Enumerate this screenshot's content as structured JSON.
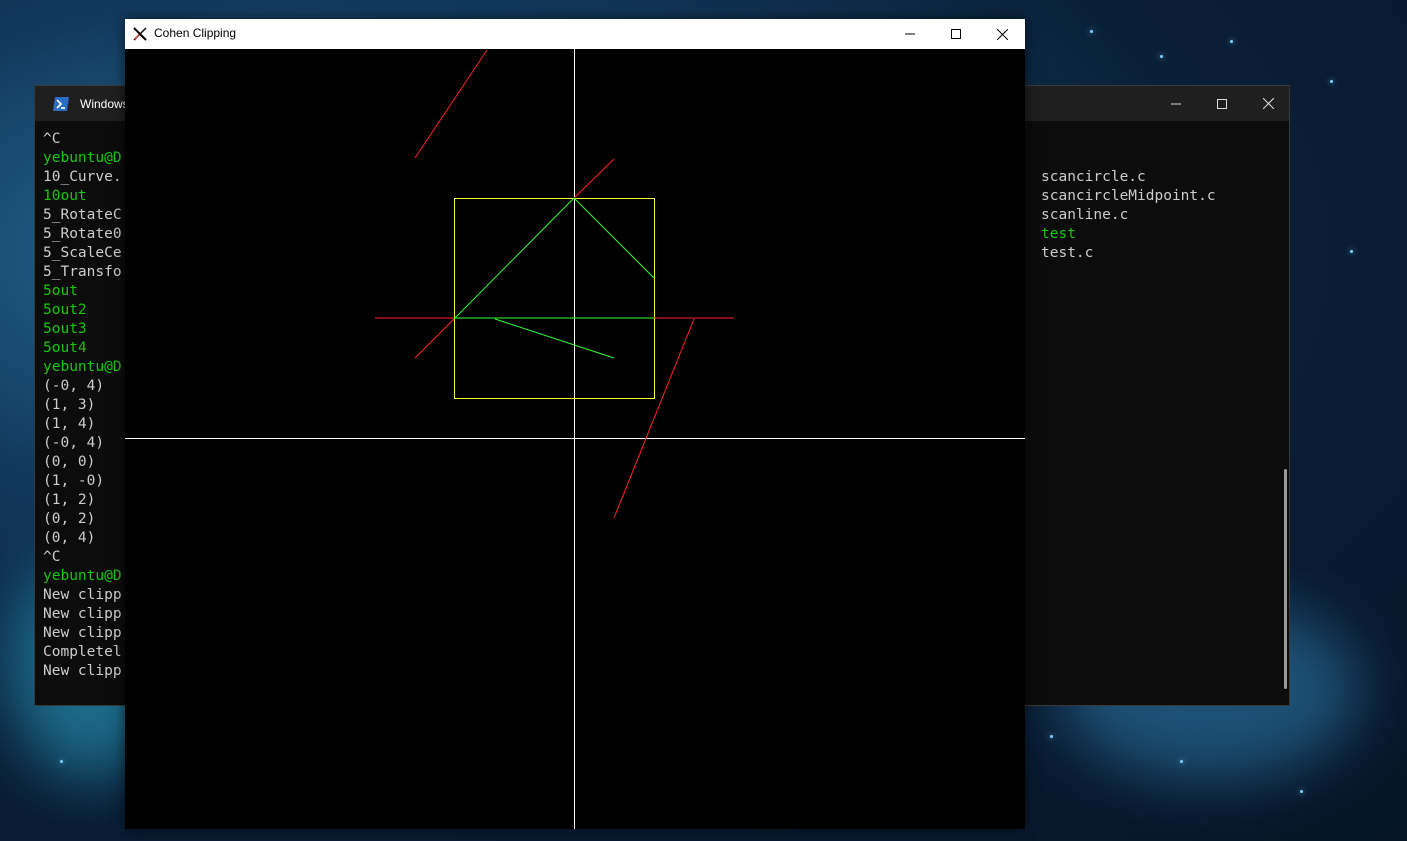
{
  "terminal": {
    "title": "Windows",
    "left_lines": [
      {
        "text": "^C",
        "color": "white"
      },
      {
        "text": "yebuntu@D",
        "color": "green"
      },
      {
        "text": "10_Curve.",
        "color": "white"
      },
      {
        "text": "10out",
        "color": "green"
      },
      {
        "text": "5_RotateC",
        "color": "white"
      },
      {
        "text": "5_Rotate0",
        "color": "white"
      },
      {
        "text": "5_ScaleCe",
        "color": "white"
      },
      {
        "text": "5_Transfo",
        "color": "white"
      },
      {
        "text": "5out",
        "color": "green"
      },
      {
        "text": "5out2",
        "color": "green"
      },
      {
        "text": "5out3",
        "color": "green"
      },
      {
        "text": "5out4",
        "color": "green"
      },
      {
        "text": "yebuntu@D",
        "color": "green"
      },
      {
        "text": "(-0, 4)",
        "color": "white"
      },
      {
        "text": "(1, 3)",
        "color": "white"
      },
      {
        "text": "(1, 4)",
        "color": "white"
      },
      {
        "text": "(-0, 4)",
        "color": "white"
      },
      {
        "text": "(0, 0)",
        "color": "white"
      },
      {
        "text": "(1, -0)",
        "color": "white"
      },
      {
        "text": "(1, 2)",
        "color": "white"
      },
      {
        "text": "(0, 2)",
        "color": "white"
      },
      {
        "text": "(0, 4)",
        "color": "white"
      },
      {
        "text": "^C",
        "color": "white"
      },
      {
        "text": "yebuntu@D",
        "color": "green"
      },
      {
        "text": "New clipp",
        "color": "white"
      },
      {
        "text": "New clipp",
        "color": "white"
      },
      {
        "text": "New clipp",
        "color": "white"
      },
      {
        "text": "Completel",
        "color": "white"
      },
      {
        "text": "New clipp",
        "color": "white"
      }
    ],
    "right_lines": [
      {
        "text": "scancircle.c",
        "color": "white"
      },
      {
        "text": "scancircleMidpoint.c",
        "color": "white"
      },
      {
        "text": "scanline.c",
        "color": "white"
      },
      {
        "text": "test",
        "color": "green"
      },
      {
        "text": "test.c",
        "color": "white"
      }
    ],
    "minimize_icon": "minimize-icon",
    "maximize_icon": "maximize-icon",
    "close_icon": "close-icon"
  },
  "clip_window": {
    "title": "Cohen Clipping",
    "app_icon": "x-logo-icon",
    "minimize_icon": "minimize-icon",
    "maximize_icon": "maximize-icon",
    "close_icon": "close-icon"
  },
  "colors": {
    "axis": "#ffffff",
    "clip_rect": "#ffff33",
    "outside_segment": "#ff2020",
    "inside_segment": "#33ff33",
    "terminal_green": "#16c60c",
    "terminal_white": "#cccccc"
  }
}
